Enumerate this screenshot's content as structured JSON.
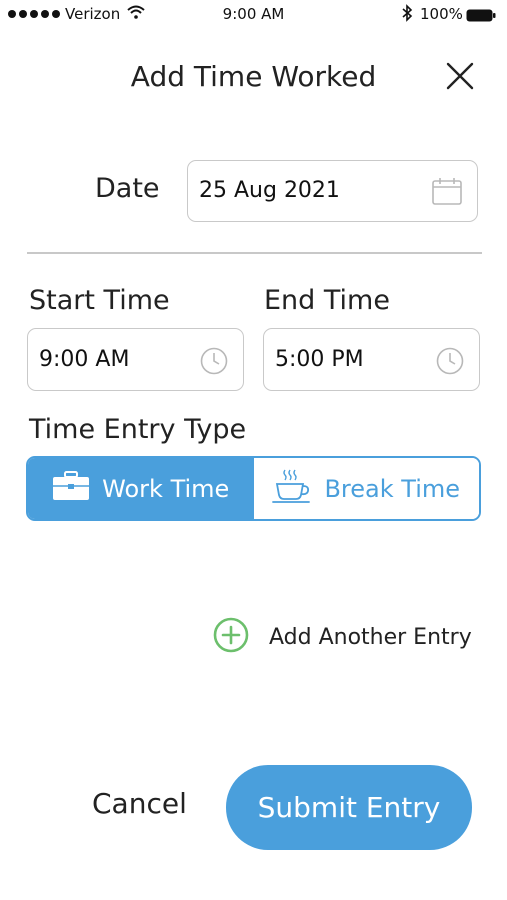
{
  "status_bar": {
    "carrier": "Verizon",
    "time": "9:00 AM",
    "battery": "100%",
    "icons": [
      "signal-dots-icon",
      "wifi-icon",
      "bluetooth-icon",
      "battery-icon"
    ]
  },
  "header": {
    "title": "Add Time Worked",
    "close_icon": "close-icon"
  },
  "date": {
    "label": "Date",
    "value": "25 Aug 2021",
    "icon": "calendar-icon"
  },
  "start_time": {
    "label": "Start Time",
    "value": "9:00 AM",
    "icon": "clock-icon"
  },
  "end_time": {
    "label": "End Time",
    "value": "5:00 PM",
    "icon": "clock-icon"
  },
  "entry_type": {
    "label": "Time Entry Type",
    "options": [
      {
        "label": "Work Time",
        "icon": "briefcase-icon",
        "selected": true
      },
      {
        "label": "Break Time",
        "icon": "coffee-cup-icon",
        "selected": false
      }
    ]
  },
  "add_entry": {
    "label": "Add Another Entry",
    "icon": "plus-circle-icon"
  },
  "actions": {
    "cancel": "Cancel",
    "submit": "Submit Entry"
  },
  "colors": {
    "accent": "#4a9fdc",
    "add_icon": "#6cbf6c",
    "field_border": "#c9c9c9"
  }
}
